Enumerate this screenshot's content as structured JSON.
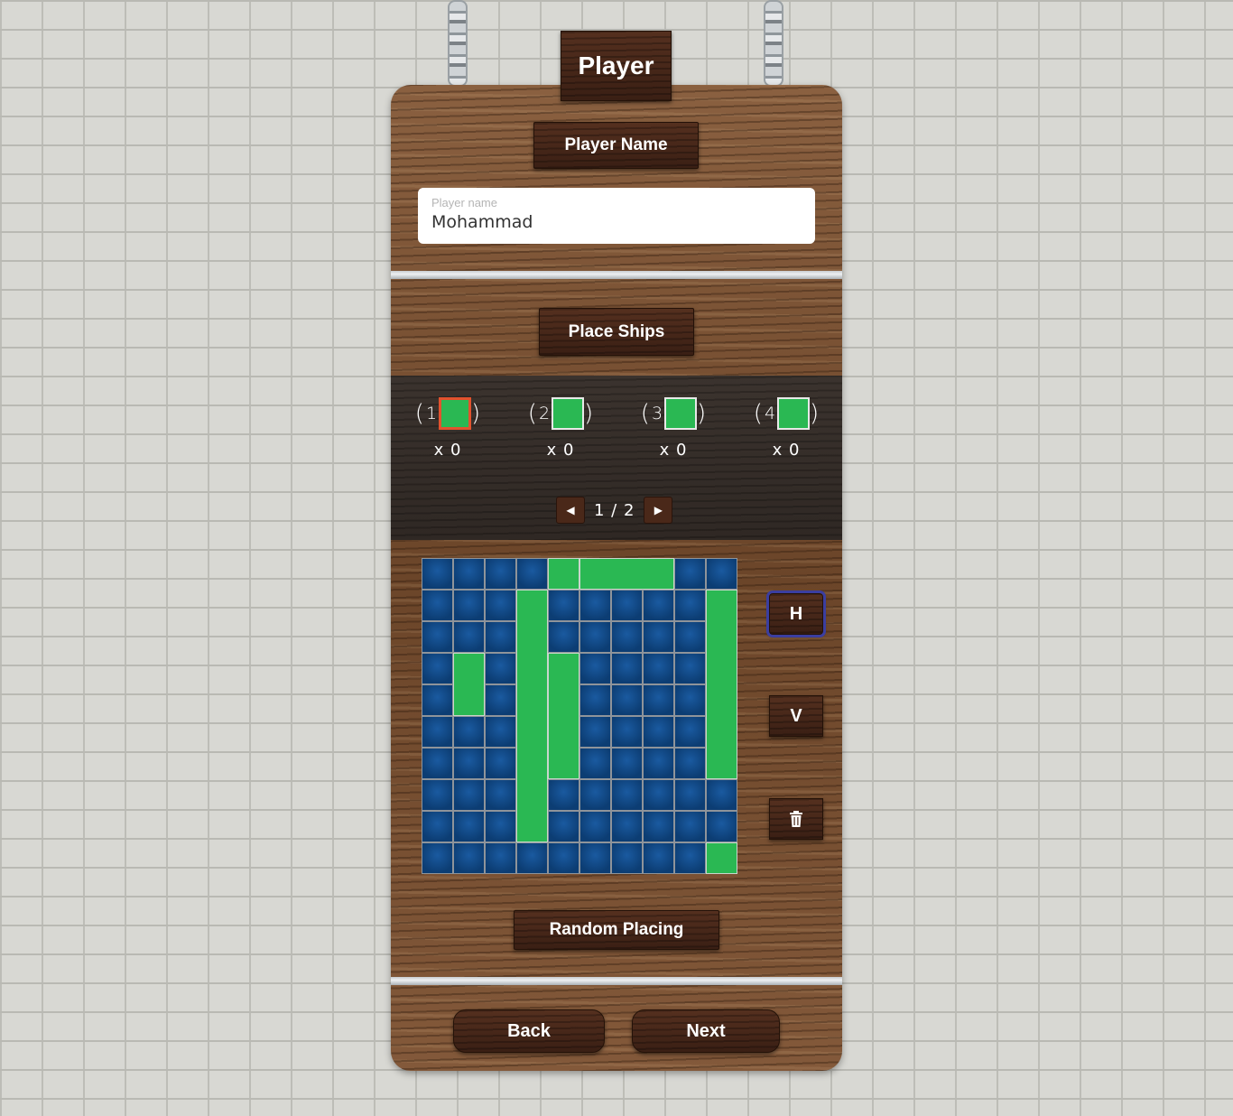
{
  "header": {
    "title": "Player"
  },
  "player_section": {
    "heading": "Player Name",
    "name_field": {
      "placeholder": "Player name",
      "value": "Mohammad"
    }
  },
  "ships_section": {
    "heading": "Place Ships",
    "ships": [
      {
        "size": "1",
        "count": "x 0",
        "selected": true
      },
      {
        "size": "2",
        "count": "x 0",
        "selected": false
      },
      {
        "size": "3",
        "count": "x 0",
        "selected": false
      },
      {
        "size": "4",
        "count": "x 0",
        "selected": false
      }
    ],
    "pager": {
      "text": "1 / 2",
      "prev_icon": "caret-left-icon",
      "next_icon": "caret-right-icon"
    }
  },
  "board": {
    "rows": 10,
    "cols": 10,
    "ship_color": "#2ab853",
    "water_color": "#0c3d73",
    "ships": [
      {
        "row": 0,
        "col": 4,
        "length": 1,
        "orientation": "H"
      },
      {
        "row": 0,
        "col": 5,
        "length": 3,
        "orientation": "H"
      },
      {
        "row": 1,
        "col": 3,
        "length": 8,
        "orientation": "V"
      },
      {
        "row": 1,
        "col": 9,
        "length": 6,
        "orientation": "V"
      },
      {
        "row": 3,
        "col": 1,
        "length": 2,
        "orientation": "V"
      },
      {
        "row": 3,
        "col": 4,
        "length": 4,
        "orientation": "V"
      },
      {
        "row": 9,
        "col": 9,
        "length": 1,
        "orientation": "V"
      }
    ]
  },
  "controls": {
    "horizontal_label": "H",
    "vertical_label": "V",
    "delete_icon": "trash-icon",
    "active": "H"
  },
  "random_button": "Random Placing",
  "nav": {
    "back_label": "Back",
    "next_label": "Next"
  }
}
